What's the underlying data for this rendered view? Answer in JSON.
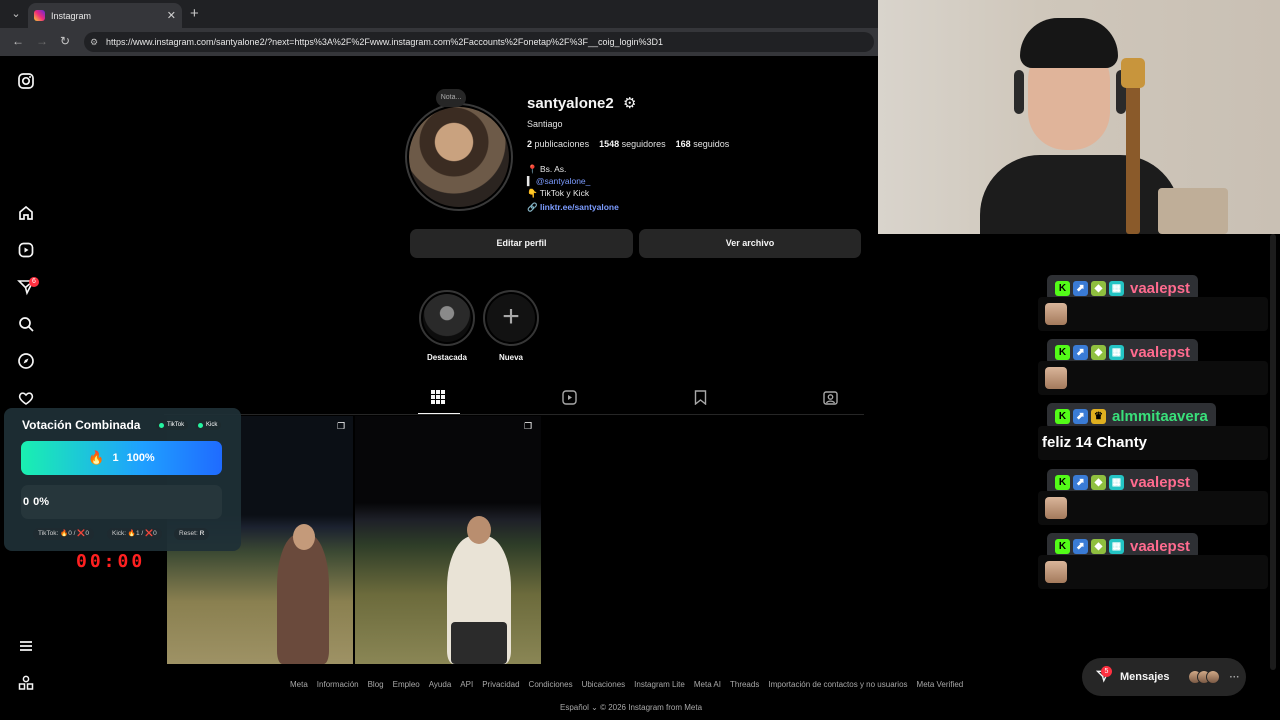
{
  "browser": {
    "tab_title": "Instagram",
    "tab_close": "✕",
    "new_tab": "+",
    "url": "https://www.instagram.com/santyalone2/?next=https%3A%2F%2Fwww.instagram.com%2Faccounts%2Fonetap%2F%3F__coig_login%3D1"
  },
  "sidebar": {
    "notification_count": "6"
  },
  "profile": {
    "note": "Nota...",
    "username": "santyalone2",
    "full_name": "Santiago",
    "posts": "2",
    "posts_label": "publicaciones",
    "followers": "1548",
    "followers_label": "seguidores",
    "following": "168",
    "following_label": "seguidos",
    "bio_lines": [
      "📍 Bs. As.",
      "@santyalone_",
      "👇 TikTok y Kick"
    ],
    "link": "linktr.ee/santyalone",
    "edit_button": "Editar perfil",
    "archive_button": "Ver archivo"
  },
  "highlights": [
    {
      "label": "Destacada"
    },
    {
      "label": "Nueva"
    }
  ],
  "footer": {
    "links": [
      "Meta",
      "Información",
      "Blog",
      "Empleo",
      "Ayuda",
      "API",
      "Privacidad",
      "Condiciones",
      "Ubicaciones",
      "Instagram Lite",
      "Meta AI",
      "Threads",
      "Importación de contactos y no usuarios",
      "Meta Verified"
    ],
    "language": "Español",
    "copyright": "© 2026 Instagram from Meta"
  },
  "vote_overlay": {
    "title": "Votación Combinada",
    "platform_a": "TikTok",
    "platform_b": "Kick",
    "bar1_count": "1",
    "bar1_percent": "100%",
    "bar2_count": "0",
    "bar2_percent": "0%",
    "tiktok_stats": "TikTok: 🔥0 / ❌0",
    "kick_stats": "Kick: 🔥1 / ❌0",
    "reset_label": "Reset:",
    "reset_key": "R",
    "timer": "00:00"
  },
  "chat": {
    "messages": [
      {
        "user": "vaalepst",
        "user_color": "#ff6b8f",
        "text": ""
      },
      {
        "user": "vaalepst",
        "user_color": "#ff6b8f",
        "text": ""
      },
      {
        "user": "almmitaavera",
        "user_color": "#39e07a",
        "text": "feliz 14 Chanty"
      },
      {
        "user": "vaalepst",
        "user_color": "#ff6b8f",
        "text": ""
      },
      {
        "user": "vaalepst",
        "user_color": "#ff6b8f",
        "text": ""
      }
    ]
  },
  "messages_pill": {
    "label": "Mensajes",
    "count": "5"
  },
  "colors": {
    "accent_link": "#7c9cff",
    "notification_red": "#ff3040",
    "timer_red": "#ff2020"
  }
}
